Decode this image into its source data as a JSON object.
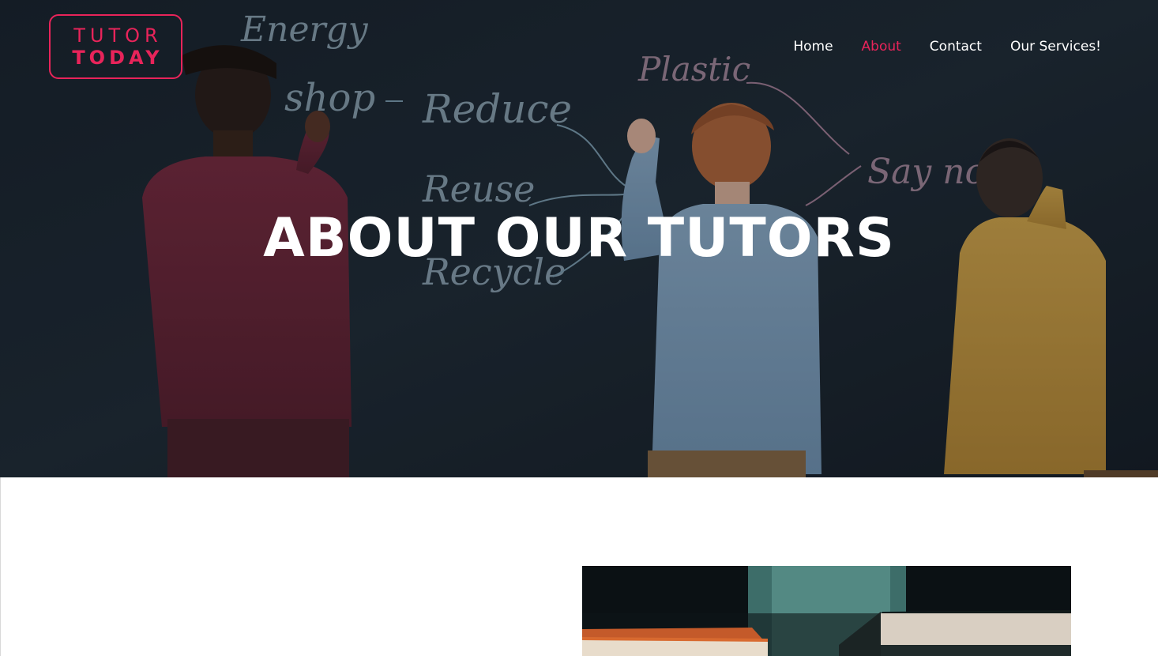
{
  "logo": {
    "line1": "TUTOR",
    "line2": "TODAY",
    "color": "#e8245a"
  },
  "nav": {
    "items": [
      {
        "label": "Home",
        "active": false
      },
      {
        "label": "About",
        "active": true
      },
      {
        "label": "Contact",
        "active": false
      },
      {
        "label": "Our Services!",
        "active": false
      }
    ],
    "active_color": "#e8245a"
  },
  "hero": {
    "title": "ABOUT OUR TUTORS",
    "chalk_words": [
      "Energy",
      "shop",
      "Reduce",
      "Reuse",
      "Recycle",
      "Plastic",
      "Say no"
    ]
  }
}
